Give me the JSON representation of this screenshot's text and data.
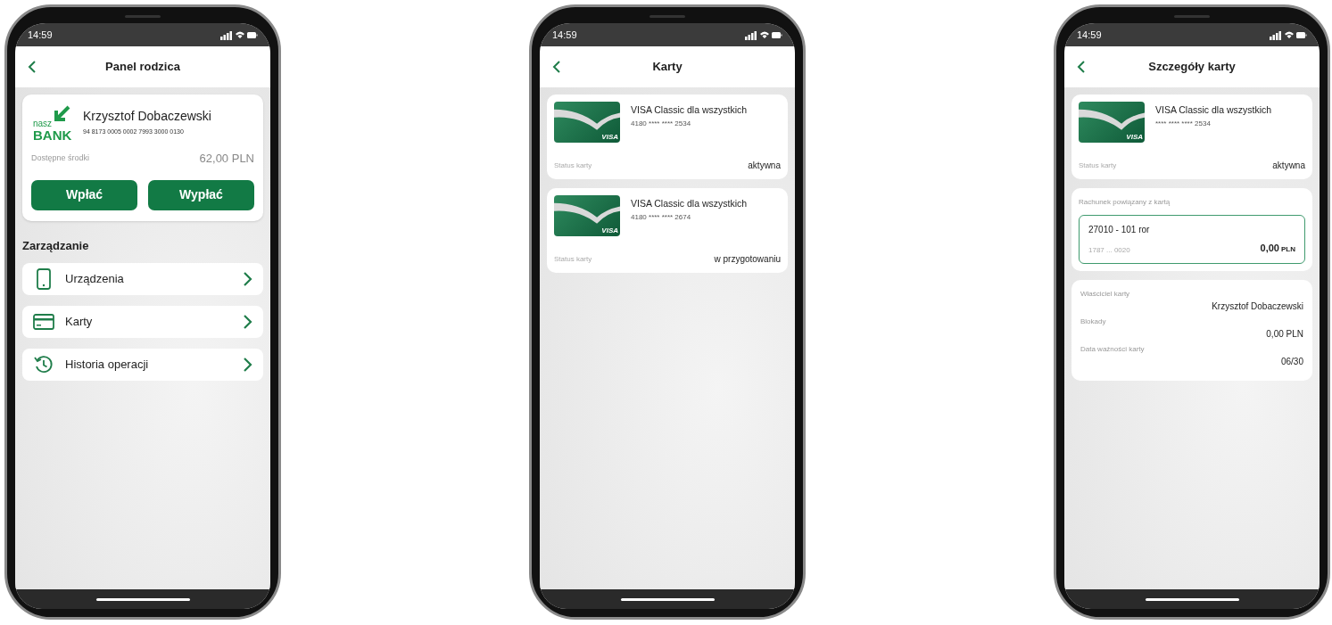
{
  "screens": [
    {
      "kind": "parent_panel",
      "status_time": "14:59",
      "title": "Panel rodzica",
      "account": {
        "logo_small": "nasz",
        "logo_big": "BANK",
        "holder": "Krzysztof Dobaczewski",
        "number": "94 8173 0005 0002 7993 3000 0130",
        "balance_label": "Dostępne środki",
        "balance": "62,00 PLN",
        "buttons": [
          "Wpłać",
          "Wypłać"
        ]
      },
      "section_title": "Zarządzanie",
      "menu": [
        {
          "kind": "device",
          "label": "Urządzenia"
        },
        {
          "kind": "card",
          "label": "Karty"
        },
        {
          "kind": "history",
          "label": "Historia operacji"
        }
      ]
    },
    {
      "kind": "cards",
      "status_time": "14:59",
      "title": "Karty",
      "cards": [
        {
          "name": "VISA Classic dla wszystkich",
          "number": "4180 **** **** 2534",
          "card_logo": "VISA",
          "status_label": "Status karty",
          "status": "aktywna"
        },
        {
          "name": "VISA Classic dla wszystkich",
          "number": "4180 **** **** 2674",
          "card_logo": "VISA",
          "status_label": "Status karty",
          "status": "w przygotowaniu"
        }
      ]
    },
    {
      "kind": "card_details",
      "status_time": "14:59",
      "title": "Szczegóły karty",
      "card": {
        "name": "VISA Classic dla wszystkich",
        "number": "**** **** **** 2534",
        "card_logo": "VISA",
        "status_label": "Status karty",
        "status": "aktywna"
      },
      "linked_account": {
        "label": "Rachunek powiązany z kartą",
        "name": "27010 - 101 ror",
        "number": "1787 ... 0020",
        "amount": "0,00",
        "currency": "PLN"
      },
      "details": [
        {
          "label": "Właściciel karty",
          "value": "Krzysztof Dobaczewski"
        },
        {
          "label": "Blokady",
          "value": "0,00 PLN"
        },
        {
          "label": "Data ważności karty",
          "value": "06/30"
        }
      ]
    }
  ]
}
